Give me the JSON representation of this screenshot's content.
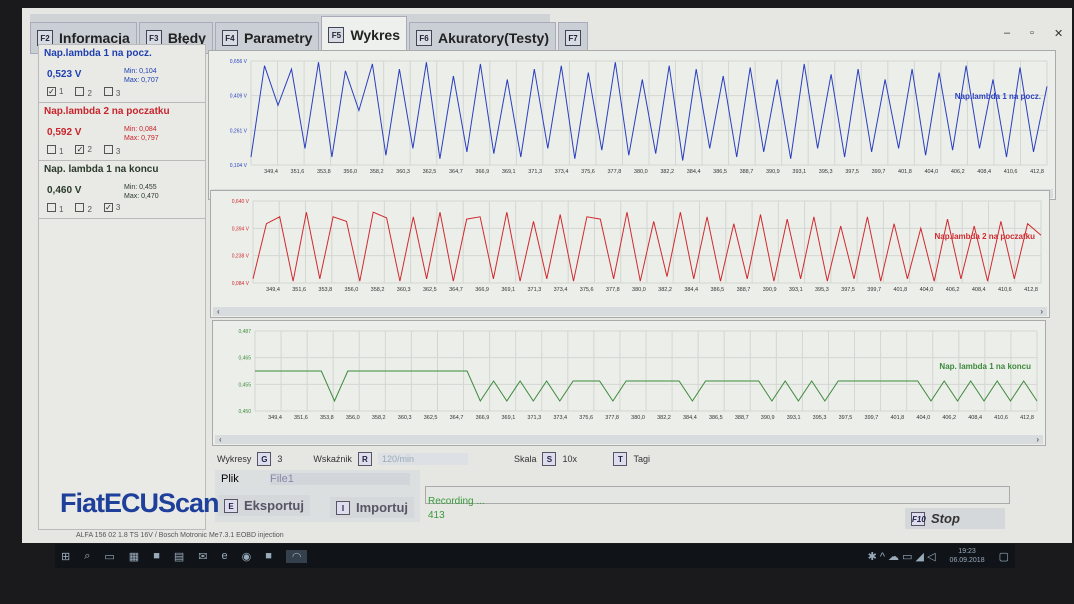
{
  "tabs": [
    {
      "key": "F2",
      "label": "Informacja"
    },
    {
      "key": "F3",
      "label": "Błędy"
    },
    {
      "key": "F4",
      "label": "Parametry"
    },
    {
      "key": "F5",
      "label": "Wykres",
      "active": true
    },
    {
      "key": "F6",
      "label": "Akuratory(Testy)"
    },
    {
      "key": "F7",
      "label": ""
    }
  ],
  "window_controls": {
    "minimize": "–",
    "maximize": "▫",
    "close": "✕"
  },
  "sensors": [
    {
      "title": "Nap.lambda 1 na pocz.",
      "value": "0,523 V",
      "min": "Min: 0,104",
      "max": "Max: 0,707",
      "color": "#1f3fb0",
      "checks": [
        {
          "label": "1",
          "checked": "✓"
        },
        {
          "label": "2",
          "checked": ""
        },
        {
          "label": "3",
          "checked": ""
        }
      ]
    },
    {
      "title": "Nap.lambda 2 na poczatku",
      "value": "0,592 V",
      "min": "Min: 0,084",
      "max": "Max: 0,797",
      "color": "#c8242c",
      "checks": [
        {
          "label": "1",
          "checked": ""
        },
        {
          "label": "2",
          "checked": "✓"
        },
        {
          "label": "3",
          "checked": ""
        }
      ]
    },
    {
      "title": "Nap. lambda 1 na koncu",
      "value": "0,460 V",
      "min": "Min: 0,455",
      "max": "Max: 0,470",
      "color": "#2b3a2b",
      "checks": [
        {
          "label": "1",
          "checked": ""
        },
        {
          "label": "2",
          "checked": ""
        },
        {
          "label": "3",
          "checked": "✓"
        }
      ]
    }
  ],
  "chart_data": [
    {
      "type": "line",
      "title": "Nap.lambda 1 na pocz.",
      "color": "#2a3fc0",
      "yticks": [
        "0,656 V",
        "0,409 V",
        "0,261 V",
        "0,104 V"
      ],
      "ylim": [
        0.104,
        0.707
      ],
      "x": [
        "349,4",
        "351,6",
        "353,8",
        "356,0",
        "358,2",
        "360,3",
        "362,5",
        "364,7",
        "366,9",
        "369,1",
        "371,3",
        "373,4",
        "375,6",
        "377,8",
        "380,0",
        "382,2",
        "384,4",
        "386,5",
        "388,7",
        "390,9",
        "393,1",
        "395,3",
        "397,5",
        "399,7",
        "401,8",
        "404,0",
        "406,2",
        "408,4",
        "410,6",
        "412,8"
      ],
      "values": [
        0.15,
        0.68,
        0.45,
        0.66,
        0.2,
        0.7,
        0.15,
        0.65,
        0.42,
        0.69,
        0.16,
        0.66,
        0.2,
        0.7,
        0.14,
        0.62,
        0.18,
        0.69,
        0.17,
        0.6,
        0.15,
        0.66,
        0.2,
        0.68,
        0.14,
        0.64,
        0.19,
        0.7,
        0.16,
        0.6,
        0.17,
        0.68,
        0.13,
        0.66,
        0.2,
        0.62,
        0.15,
        0.67,
        0.18,
        0.6,
        0.14,
        0.69,
        0.2,
        0.63,
        0.15,
        0.66,
        0.18,
        0.6,
        0.2,
        0.66,
        0.16,
        0.64,
        0.19,
        0.68,
        0.2,
        0.6,
        0.15,
        0.67,
        0.18,
        0.56
      ]
    },
    {
      "type": "line",
      "title": "Nap.lambda 2 na poczatku",
      "color": "#d02a30",
      "yticks": [
        "0,640 V",
        "0,394 V",
        "0,238 V",
        "0,084 V"
      ],
      "ylim": [
        0.084,
        0.797
      ],
      "x": [
        "349,4",
        "351,6",
        "353,8",
        "356,0",
        "358,2",
        "360,3",
        "362,5",
        "364,7",
        "366,9",
        "369,1",
        "371,3",
        "373,4",
        "375,6",
        "377,8",
        "380,0",
        "382,2",
        "384,4",
        "386,5",
        "388,7",
        "390,9",
        "393,1",
        "395,3",
        "397,5",
        "399,7",
        "401,8",
        "404,0",
        "406,2",
        "408,4",
        "410,6",
        "412,8"
      ],
      "values": [
        0.12,
        0.6,
        0.66,
        0.1,
        0.7,
        0.12,
        0.66,
        0.62,
        0.1,
        0.7,
        0.65,
        0.1,
        0.66,
        0.12,
        0.7,
        0.1,
        0.64,
        0.66,
        0.12,
        0.7,
        0.1,
        0.62,
        0.12,
        0.68,
        0.1,
        0.66,
        0.64,
        0.12,
        0.7,
        0.1,
        0.62,
        0.14,
        0.7,
        0.12,
        0.66,
        0.1,
        0.6,
        0.12,
        0.68,
        0.1,
        0.64,
        0.12,
        0.66,
        0.1,
        0.58,
        0.12,
        0.66,
        0.1,
        0.6,
        0.12,
        0.56,
        0.1,
        0.64,
        0.12,
        0.58,
        0.1,
        0.62,
        0.12,
        0.6,
        0.5
      ]
    },
    {
      "type": "line",
      "title": "Nap. lambda 1 na koncu",
      "color": "#3c8a3c",
      "yticks": [
        "0,487",
        "0,465",
        "0,455",
        "0,450"
      ],
      "ylim": [
        0.45,
        0.49
      ],
      "x": [
        "349,4",
        "351,6",
        "353,8",
        "356,0",
        "358,2",
        "360,3",
        "362,5",
        "364,7",
        "366,9",
        "369,1",
        "371,3",
        "373,4",
        "375,6",
        "377,8",
        "380,0",
        "382,2",
        "384,4",
        "386,5",
        "388,7",
        "390,9",
        "393,1",
        "395,3",
        "397,5",
        "399,7",
        "401,8",
        "404,0",
        "406,2",
        "408,4",
        "410,6",
        "412,8"
      ],
      "values": [
        0.47,
        0.47,
        0.47,
        0.47,
        0.47,
        0.47,
        0.455,
        0.47,
        0.47,
        0.47,
        0.47,
        0.47,
        0.47,
        0.47,
        0.47,
        0.47,
        0.47,
        0.455,
        0.465,
        0.455,
        0.465,
        0.455,
        0.465,
        0.455,
        0.465,
        0.465,
        0.465,
        0.455,
        0.465,
        0.465,
        0.465,
        0.465,
        0.465,
        0.455,
        0.465,
        0.465,
        0.465,
        0.465,
        0.465,
        0.455,
        0.465,
        0.455,
        0.465,
        0.455,
        0.465,
        0.465,
        0.465,
        0.465,
        0.465,
        0.465,
        0.465,
        0.455,
        0.465,
        0.455,
        0.465,
        0.455,
        0.465,
        0.455,
        0.465,
        0.455
      ]
    }
  ],
  "controls": {
    "wykresy_label": "Wykresy",
    "wykresy_key": "G",
    "wykresy_value": "3",
    "wskaznik_label": "Wskaźnik",
    "wskaznik_key": "R",
    "wskaznik_value": "120/min",
    "skala_label": "Skala",
    "skala_key": "S",
    "skala_value": "10x",
    "tagi_key": "T",
    "tagi_label": "Tagi"
  },
  "file": {
    "label": "Plik",
    "value": "File1",
    "export_key": "E",
    "export_label": "Eksportuj",
    "import_key": "I",
    "import_label": "Importuj"
  },
  "recording": {
    "status": "Recording ...",
    "count": "413"
  },
  "stop": {
    "key": "F10",
    "label": "Stop"
  },
  "logo": "FiatECUScan",
  "status_bar": "ALFA 156 02 1.8 TS 16V / Bosch Motronic Me7.3.1 EOBD injection",
  "taskbar": {
    "time": "19:23",
    "date": "06.09.2018"
  }
}
